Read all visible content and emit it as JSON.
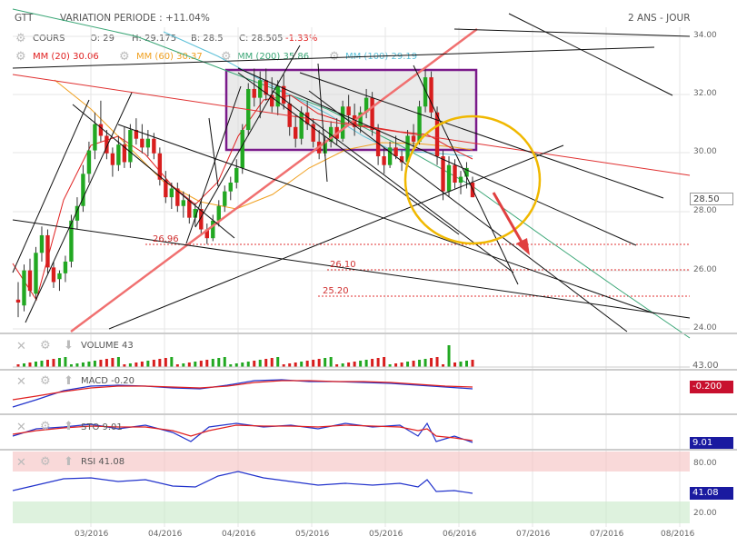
{
  "header": {
    "ticker": "GTT",
    "variation": "VARIATION PERIODE : +11.04%",
    "period": "2 ANS - JOUR"
  },
  "ohlc": {
    "label": "COURS",
    "o": "O: 29",
    "h": "H: 29.175",
    "b": "B: 28.5",
    "c": "C: 28.505",
    "change": "-1.33%"
  },
  "mas": [
    {
      "label": "MM (20) 30.06",
      "color": "#e02020"
    },
    {
      "label": "MM (60) 30.37",
      "color": "#f0a020"
    },
    {
      "label": "MM (200) 35.86",
      "color": "#3aa676"
    },
    {
      "label": "MM (100) 29.19",
      "color": "#5cc0d8"
    }
  ],
  "price_axis": {
    "labels": [
      "34.00",
      "32.00",
      "30.00",
      "28.00",
      "26.00",
      "24.00"
    ],
    "last_price": "28.50"
  },
  "levels": [
    {
      "value": "26.96"
    },
    {
      "value": "26.10"
    },
    {
      "value": "25.20"
    }
  ],
  "volume": {
    "label": "VOLUME 43",
    "tag": "43.00"
  },
  "macd": {
    "label": "MACD -0.20",
    "tag": "-0.200"
  },
  "sto": {
    "label": "STO 9.01",
    "tag": "9.01"
  },
  "rsi": {
    "label": "RSI 41.08",
    "axis": [
      "80.00",
      "20.00"
    ],
    "tag": "41.08"
  },
  "x_axis": [
    "03/2016",
    "04/2016",
    "04/2016",
    "05/2016",
    "05/2016",
    "06/2016",
    "07/2016",
    "07/2016",
    "08/2016"
  ],
  "chart_data": {
    "type": "candlestick",
    "title": "GTT",
    "ylim": [
      24,
      34
    ],
    "candles": [
      [
        25.0,
        25.6,
        24.4,
        24.9
      ],
      [
        24.8,
        26.2,
        24.6,
        26.0
      ],
      [
        26.0,
        26.4,
        25.1,
        25.3
      ],
      [
        25.2,
        26.8,
        25.0,
        26.6
      ],
      [
        26.6,
        27.5,
        26.3,
        27.2
      ],
      [
        27.2,
        27.4,
        25.9,
        26.1
      ],
      [
        26.1,
        26.3,
        25.4,
        25.6
      ],
      [
        25.7,
        26.0,
        25.3,
        25.9
      ],
      [
        25.9,
        26.5,
        25.6,
        26.3
      ],
      [
        26.3,
        27.9,
        26.1,
        27.7
      ],
      [
        27.7,
        28.5,
        27.4,
        28.2
      ],
      [
        28.2,
        29.6,
        28.0,
        29.3
      ],
      [
        29.3,
        30.4,
        29.0,
        30.1
      ],
      [
        30.1,
        31.4,
        29.8,
        31.0
      ],
      [
        31.0,
        31.8,
        30.4,
        30.6
      ],
      [
        30.6,
        30.8,
        29.8,
        30.0
      ],
      [
        30.0,
        30.2,
        29.2,
        29.6
      ],
      [
        29.6,
        30.6,
        29.4,
        30.3
      ],
      [
        30.3,
        30.9,
        29.5,
        29.7
      ],
      [
        29.7,
        31.0,
        29.5,
        30.8
      ],
      [
        30.8,
        31.2,
        30.3,
        30.5
      ],
      [
        30.5,
        31.0,
        30.0,
        30.2
      ],
      [
        30.2,
        30.8,
        29.9,
        30.5
      ],
      [
        30.5,
        30.7,
        29.8,
        30.0
      ],
      [
        30.0,
        30.2,
        28.9,
        29.1
      ],
      [
        29.1,
        29.4,
        28.3,
        28.5
      ],
      [
        28.5,
        29.0,
        28.1,
        28.8
      ],
      [
        28.8,
        29.0,
        28.0,
        28.2
      ],
      [
        28.2,
        28.7,
        27.8,
        28.4
      ],
      [
        28.4,
        28.6,
        27.6,
        27.8
      ],
      [
        27.8,
        28.3,
        27.5,
        28.1
      ],
      [
        28.1,
        28.4,
        27.2,
        27.4
      ],
      [
        27.4,
        27.6,
        26.9,
        27.1
      ],
      [
        27.1,
        27.9,
        27.0,
        27.7
      ],
      [
        27.7,
        28.4,
        27.5,
        28.2
      ],
      [
        28.2,
        28.9,
        28.0,
        28.7
      ],
      [
        28.7,
        29.2,
        28.4,
        29.0
      ],
      [
        29.0,
        29.8,
        28.8,
        29.5
      ],
      [
        29.5,
        31.0,
        29.3,
        30.8
      ],
      [
        30.8,
        32.4,
        30.6,
        32.2
      ],
      [
        32.2,
        32.9,
        31.6,
        31.9
      ],
      [
        31.9,
        32.8,
        31.2,
        32.5
      ],
      [
        32.5,
        32.9,
        31.8,
        32.0
      ],
      [
        32.0,
        32.6,
        31.4,
        31.6
      ],
      [
        31.6,
        32.5,
        31.3,
        32.3
      ],
      [
        32.3,
        32.7,
        31.5,
        31.7
      ],
      [
        31.7,
        32.0,
        30.6,
        30.9
      ],
      [
        30.9,
        31.3,
        30.2,
        30.5
      ],
      [
        30.5,
        31.6,
        30.3,
        31.4
      ],
      [
        31.4,
        31.8,
        30.8,
        31.0
      ],
      [
        31.0,
        31.2,
        30.2,
        30.4
      ],
      [
        30.4,
        30.8,
        29.8,
        30.0
      ],
      [
        30.0,
        30.6,
        29.9,
        30.4
      ],
      [
        30.4,
        31.1,
        30.2,
        30.9
      ],
      [
        30.9,
        31.2,
        30.3,
        30.5
      ],
      [
        30.5,
        31.8,
        30.4,
        31.6
      ],
      [
        31.6,
        32.0,
        31.0,
        31.3
      ],
      [
        31.3,
        31.7,
        30.6,
        30.9
      ],
      [
        30.9,
        31.6,
        30.7,
        31.4
      ],
      [
        31.4,
        32.2,
        31.2,
        31.9
      ],
      [
        31.9,
        32.1,
        30.6,
        30.8
      ],
      [
        30.8,
        31.0,
        29.6,
        29.9
      ],
      [
        29.9,
        30.2,
        29.3,
        29.6
      ],
      [
        29.6,
        30.4,
        29.5,
        30.2
      ],
      [
        30.2,
        30.6,
        29.8,
        29.9
      ],
      [
        29.9,
        30.1,
        29.4,
        29.7
      ],
      [
        29.7,
        30.8,
        29.6,
        30.6
      ],
      [
        30.6,
        31.0,
        30.2,
        30.4
      ],
      [
        30.4,
        31.8,
        30.3,
        31.6
      ],
      [
        31.6,
        32.9,
        31.4,
        32.6
      ],
      [
        32.6,
        32.8,
        31.2,
        31.4
      ],
      [
        31.4,
        31.6,
        29.6,
        29.9
      ],
      [
        29.9,
        30.1,
        28.4,
        28.7
      ],
      [
        28.7,
        29.9,
        28.5,
        29.6
      ],
      [
        29.6,
        29.8,
        28.8,
        29.0
      ],
      [
        29.0,
        29.4,
        28.6,
        29.2
      ],
      [
        29.2,
        29.7,
        28.8,
        29.5
      ],
      [
        29.0,
        29.2,
        28.5,
        28.5
      ]
    ]
  }
}
